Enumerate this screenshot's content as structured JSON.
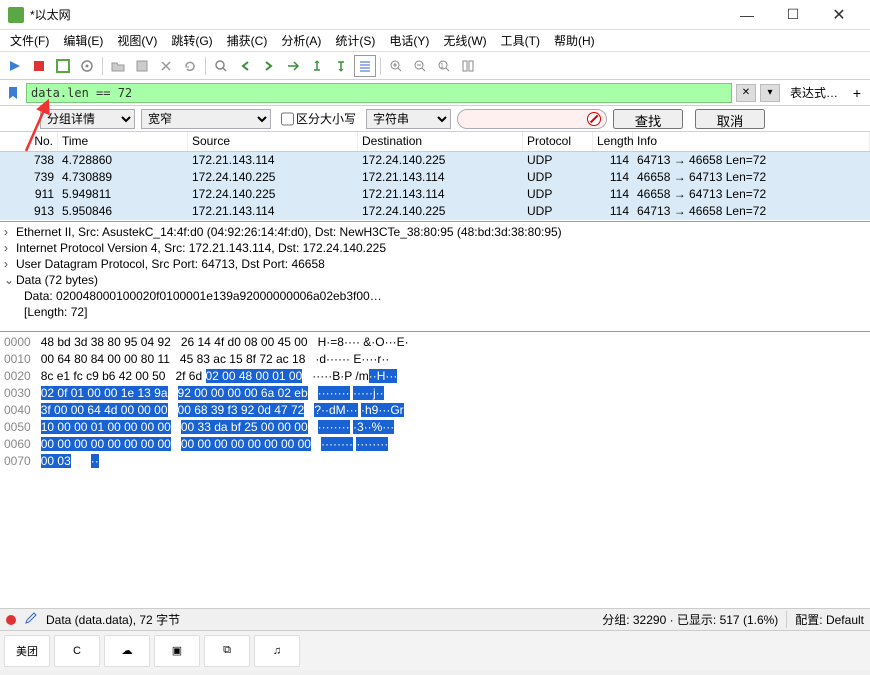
{
  "window": {
    "title": "*以太网",
    "min": "—",
    "max": "☐",
    "close": "✕"
  },
  "menu": {
    "file": "文件(F)",
    "edit": "编辑(E)",
    "view": "视图(V)",
    "go": "跳转(G)",
    "capture": "捕获(C)",
    "analyze": "分析(A)",
    "stats": "统计(S)",
    "telephony": "电话(Y)",
    "wireless": "无线(W)",
    "tools": "工具(T)",
    "help": "帮助(H)"
  },
  "filter": {
    "value": "data.len == 72",
    "expr_label": "表达式…",
    "clear": "✕",
    "dropdown": "▾",
    "plus": "+"
  },
  "search": {
    "mode": "分组详情",
    "width": "宽窄",
    "case_label": "区分大小写",
    "stringtype": "字符串",
    "search_btn": "查找",
    "cancel_btn": "取消"
  },
  "columns": {
    "no": "No.",
    "time": "Time",
    "source": "Source",
    "destination": "Destination",
    "protocol": "Protocol",
    "length": "Length",
    "info": "Info"
  },
  "packets": [
    {
      "no": "738",
      "time": "4.728860",
      "src": "172.21.143.114",
      "dst": "172.24.140.225",
      "proto": "UDP",
      "len": "114",
      "info": "64713 → 46658 Len=72"
    },
    {
      "no": "739",
      "time": "4.730889",
      "src": "172.24.140.225",
      "dst": "172.21.143.114",
      "proto": "UDP",
      "len": "114",
      "info": "46658 → 64713 Len=72"
    },
    {
      "no": "911",
      "time": "5.949811",
      "src": "172.24.140.225",
      "dst": "172.21.143.114",
      "proto": "UDP",
      "len": "114",
      "info": "46658 → 64713 Len=72"
    },
    {
      "no": "913",
      "time": "5.950846",
      "src": "172.21.143.114",
      "dst": "172.24.140.225",
      "proto": "UDP",
      "len": "114",
      "info": "64713 → 46658 Len=72"
    }
  ],
  "details": {
    "eth": "Ethernet II, Src: AsustekC_14:4f:d0 (04:92:26:14:4f:d0), Dst: NewH3CTe_38:80:95 (48:bd:3d:38:80:95)",
    "ip": "Internet Protocol Version 4, Src: 172.21.143.114, Dst: 172.24.140.225",
    "udp": "User Datagram Protocol, Src Port: 64713, Dst Port: 46658",
    "data": "Data (72 bytes)",
    "data_inner": "Data: 020048000100020f0100001e139a92000000006a02eb3f00…",
    "length_inner": "[Length: 72]"
  },
  "hex": {
    "rows": [
      {
        "off": "0000",
        "lhex": "48 bd 3d 38 80 95 04 92",
        "rhex": "26 14 4f d0 08 00 45 00",
        "lasc": "H·=8····",
        "rasc": "&·O···E·"
      },
      {
        "off": "0010",
        "lhex": "00 64 80 84 00 00 80 11",
        "rhex": "45 83 ac 15 8f 72 ac 18",
        "lasc": "·d······",
        "rasc": "E····r··"
      },
      {
        "off": "0020",
        "lhex": "8c e1 fc c9 b6 42 00 50",
        "rhex": "2f 6d ",
        "rhex_hl": "02 00 48 00 01 00",
        "lasc": "·····B·P",
        "rasc": "/m",
        "rasc_hl": "··H···"
      },
      {
        "off": "0030",
        "lhex_hl": "02 0f 01 00 00 1e 13 9a",
        "rhex_hl": "92 00 00 00 00 6a 02 eb",
        "lasc_hl": "········",
        "rasc_hl": "·····j··"
      },
      {
        "off": "0040",
        "lhex_hl": "3f 00 00 64 4d 00 00 00",
        "rhex_hl": "00 68 39 f3 92 0d 47 72",
        "lasc_hl": "?··dM···",
        "rasc_hl": "·h9···Gr"
      },
      {
        "off": "0050",
        "lhex_hl": "10 00 00 01 00 00 00 00",
        "rhex_hl": "00 33 da bf 25 00 00 00",
        "lasc_hl": "········",
        "rasc_hl": "·3··%···"
      },
      {
        "off": "0060",
        "lhex_hl": "00 00 00 00 00 00 00 00",
        "rhex_hl": "00 00 00 00 00 00 00 00",
        "lasc_hl": "········",
        "rasc_hl": "········"
      },
      {
        "off": "0070",
        "lhex_hl": "00 03",
        "rhex": "",
        "lasc_hl": "··",
        "rasc": ""
      }
    ]
  },
  "status": {
    "left": "Data (data.data), 72 字节",
    "packets": "分组: 32290 · 已显示: 517 (1.6%)",
    "profile": "配置: Default"
  },
  "taskbar": {
    "items": [
      "美团",
      "C",
      "☁",
      "▣",
      "⧉",
      "♫"
    ]
  }
}
